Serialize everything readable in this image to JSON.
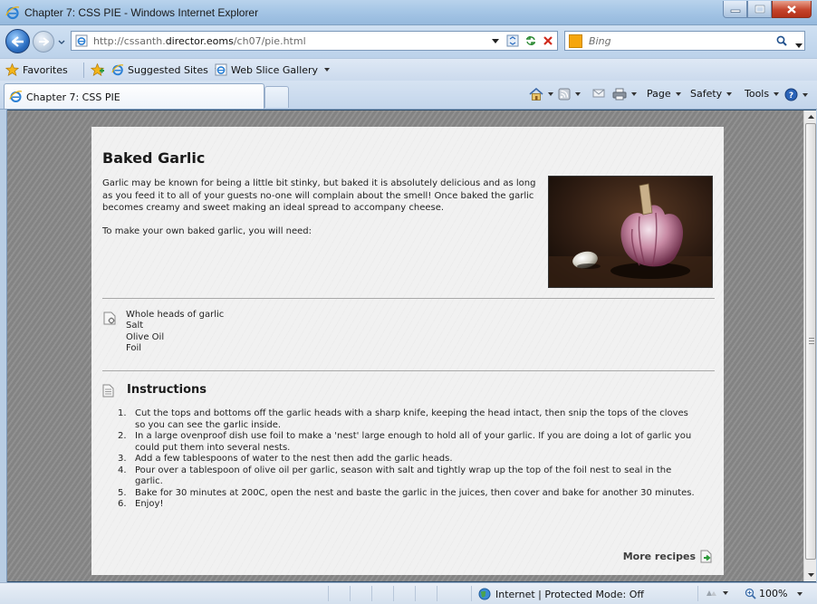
{
  "window": {
    "title": "Chapter 7: CSS PIE - Windows Internet Explorer"
  },
  "address": {
    "url_prefix": "http://cssanth.",
    "url_domain": "director.eoms",
    "url_path": "/ch07/pie.html",
    "search_placeholder": "Bing"
  },
  "favorites": {
    "favorites_label": "Favorites",
    "suggested_sites": "Suggested Sites",
    "web_slice_gallery": "Web Slice Gallery"
  },
  "tab": {
    "label": "Chapter 7: CSS PIE"
  },
  "commands": {
    "page": "Page",
    "safety": "Safety",
    "tools": "Tools"
  },
  "article": {
    "title": "Baked Garlic",
    "intro": "Garlic may be known for being a little bit stinky, but baked it is absolutely delicious and as long as you feed it to all of your guests no-one will complain about the smell! Once baked the garlic becomes creamy and sweet making an ideal spread to accompany cheese.",
    "need": "To make your own baked garlic, you will need:",
    "ingredients": [
      "Whole heads of garlic",
      "Salt",
      "Olive Oil",
      "Foil"
    ],
    "instructions_heading": "Instructions",
    "steps": [
      {
        "num": "1.",
        "text": "Cut the tops and bottoms off the garlic heads with a sharp knife, keeping the head intact, then snip the tops of the cloves so you can see the garlic inside."
      },
      {
        "num": "2.",
        "text": "In a large ovenproof dish use foil to make a 'nest' large enough to hold all of your garlic. If you are doing a lot of garlic you could put them into several nests."
      },
      {
        "num": "3.",
        "text": "Add a few tablespoons of water to the nest then add the garlic heads."
      },
      {
        "num": "4.",
        "text": "Pour over a tablespoon of olive oil per garlic, season with salt and tightly wrap up the top of the foil nest to seal in the garlic."
      },
      {
        "num": "5.",
        "text": "Bake for 30 minutes at 200C, open the nest and baste the garlic in the juices, then cover and bake for another 30 minutes."
      },
      {
        "num": "6.",
        "text": "Enjoy!"
      }
    ],
    "more_recipes": "More recipes"
  },
  "status": {
    "zone": "Internet | Protected Mode: Off",
    "zoom": "100%"
  },
  "colors": {
    "chrome_blue": "#bcd2ea",
    "page_bg": "#8a8a8a",
    "card_bg": "#f1f1f1"
  }
}
